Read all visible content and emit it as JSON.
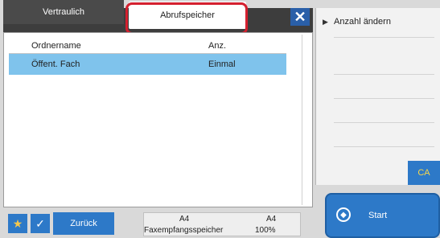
{
  "tabs": {
    "vertraulich": "Vertraulich",
    "abrufspeicher": "Abrufspeicher"
  },
  "close_icon": "close-icon",
  "list": {
    "headers": [
      "Ordnername",
      "Anz."
    ],
    "rows": [
      {
        "name": "Öffent. Fach",
        "count": "Einmal",
        "selected": true
      }
    ]
  },
  "right_panel": {
    "label": "Anzahl ändern",
    "ca": "CA",
    "start": "Start"
  },
  "bottom": {
    "back": "Zurück",
    "paper_left": "A4",
    "paper_right": "A4",
    "memory_label": "Faxempfangsspeicher",
    "memory_value": "100%"
  },
  "colors": {
    "accent": "#2d79c8",
    "selection": "#7fc3ec",
    "highlight": "#d4202f"
  }
}
